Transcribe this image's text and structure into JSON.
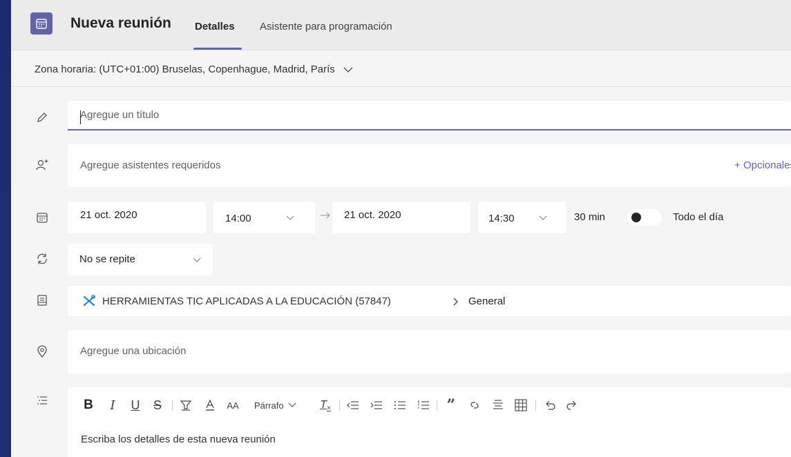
{
  "header": {
    "title": "Nueva reunión",
    "tabs": [
      {
        "label": "Detalles",
        "active": true
      },
      {
        "label": "Asistente para programación",
        "active": false
      }
    ],
    "accent_color": "#6264a7"
  },
  "timezone": {
    "label": "Zona horaria: (UTC+01:00) Bruselas, Copenhague, Madrid, París"
  },
  "form": {
    "title_placeholder": "Agregue un título",
    "attendees_placeholder": "Agregue asistentes requeridos",
    "optional_link": "+ Opcionales",
    "start_date": "21 oct. 2020",
    "start_time": "14:00",
    "end_date": "21 oct. 2020",
    "end_time": "14:30",
    "duration": "30 min",
    "all_day_label": "Todo el día",
    "all_day": false,
    "repeat": "No se repite",
    "channel_team": "HERRAMIENTAS TIC APLICADAS A LA EDUCACIÓN (57847)",
    "channel_name": "General",
    "location_placeholder": "Agregue una ubicación"
  },
  "editor": {
    "toolbar": {
      "bold": "B",
      "italic": "I",
      "underline": "U",
      "strike": "S",
      "font_size": "AA",
      "paragraph": "Párrafo",
      "clear_format": "T",
      "quote": "”"
    },
    "placeholder": "Escriba los detalles de esta nueva reunión"
  }
}
